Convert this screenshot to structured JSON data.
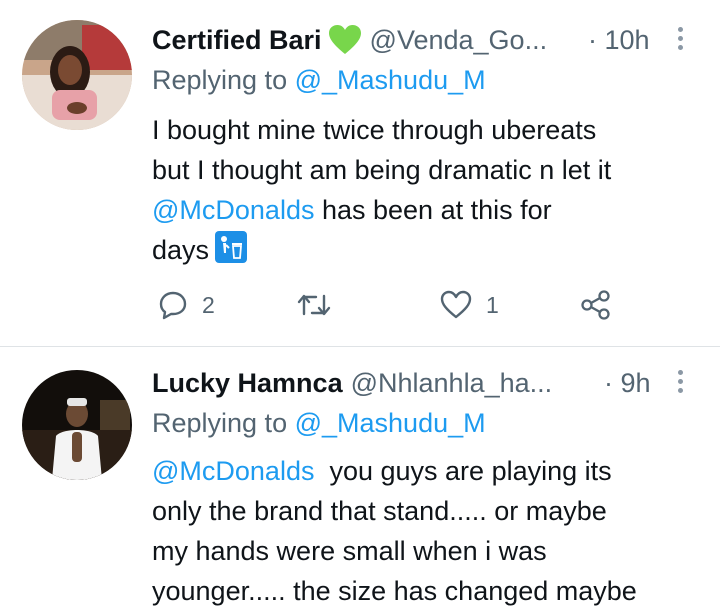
{
  "tweets": [
    {
      "name": "Certified Bari",
      "name_emoji": "green-heart",
      "handle": "@Venda_Go...",
      "time": "· 10h",
      "replying_prefix": "Replying to",
      "replying_to": "@_Mashudu_M",
      "text_lines": [
        "I bought mine twice through ubereats",
        "but I thought am being dramatic n let it"
      ],
      "line3_mention": "@McDonalds",
      "line3_rest": " has been at this for",
      "line4_text": "days",
      "line4_emoji": "litter-bin-icon",
      "reply_count": "2",
      "retweet_count": "",
      "like_count": "1"
    },
    {
      "name": "Lucky Hamnca",
      "handle": "@Nhlanhla_ha...",
      "time": "· 9h",
      "replying_prefix": "Replying to",
      "replying_to": "@_Mashudu_M",
      "line1_mention": "@McDonalds",
      "line1_rest": "  you guys are playing its",
      "text_lines": [
        "only the brand that stand..... or maybe",
        "my hands were small when i was",
        "younger..... the size has changed maybe"
      ]
    }
  ],
  "colors": {
    "accent": "#1d9bf0",
    "secondary_text": "#536471",
    "heart": "#78d64b"
  }
}
